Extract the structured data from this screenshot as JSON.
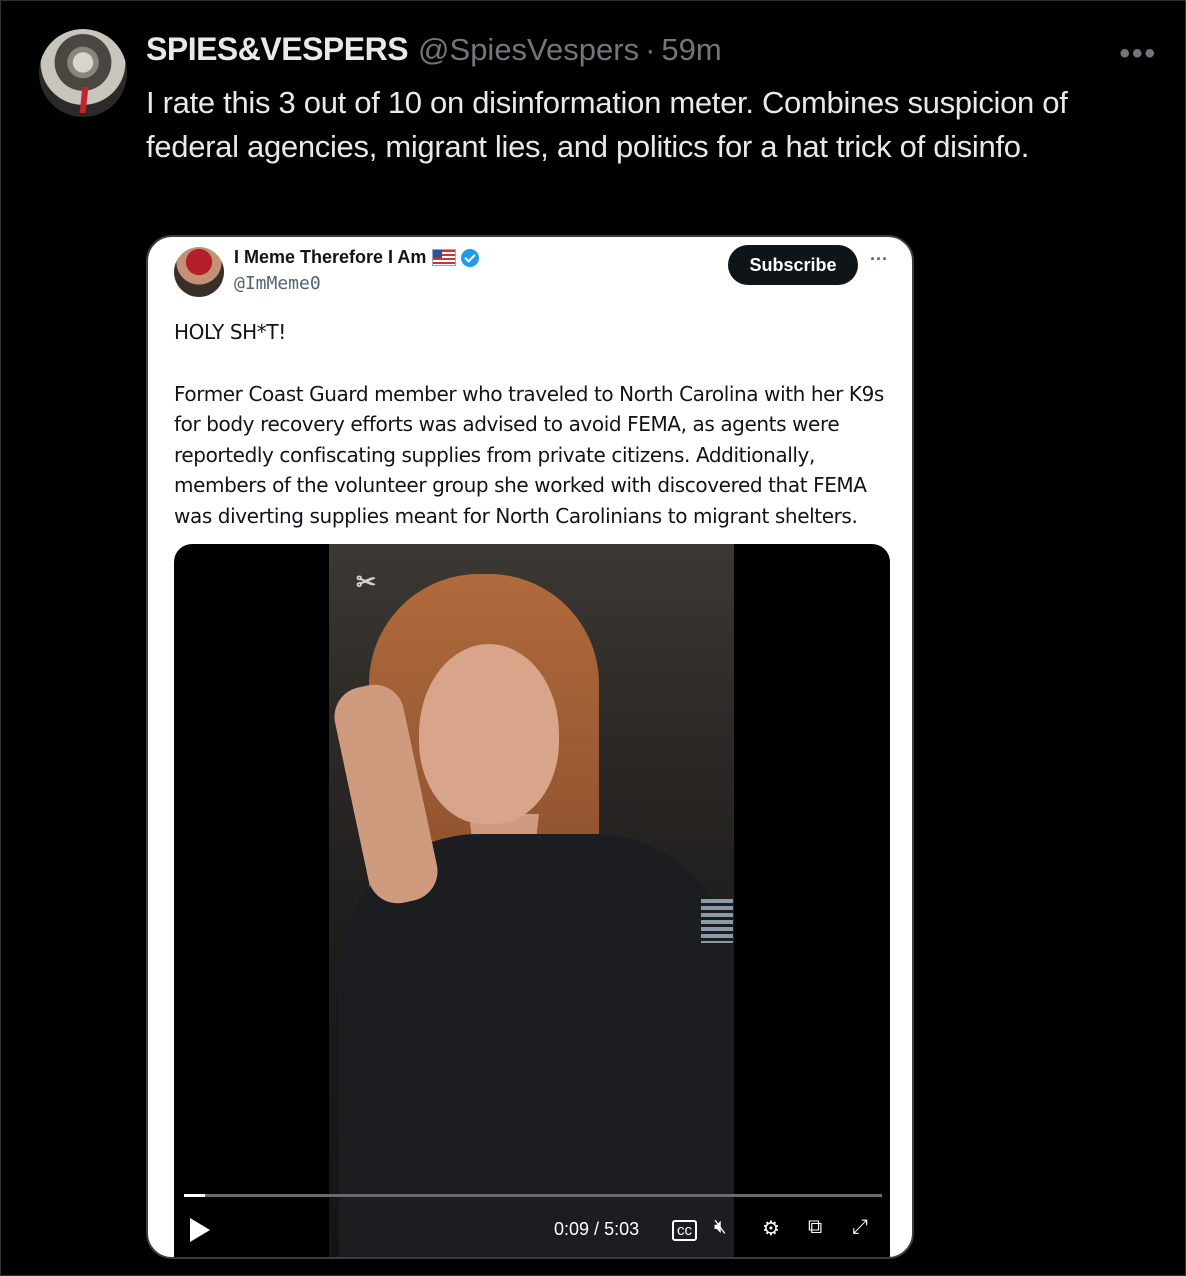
{
  "tweet": {
    "display_name": "SPIES&VESPERS",
    "handle": "@SpiesVespers",
    "separator": "·",
    "age": "59m",
    "more_label": "•••",
    "text": "I rate this 3 out of 10 on disinformation meter. Combines suspicion of federal agencies, migrant lies, and politics for a hat trick of disinfo."
  },
  "quoted": {
    "display_name": "I Meme Therefore I Am",
    "handle": "@ImMeme0",
    "subscribe_label": "Subscribe",
    "more_label": "···",
    "headline": "HOLY SH*T!",
    "body": "Former Coast Guard member who traveled to North Carolina with her K9s for body recovery efforts was advised to avoid FEMA, as agents were reportedly confiscating supplies from private citizens. Additionally, members of the volunteer group she worked with discovered that FEMA was diverting supplies meant for North Carolinians to migrant shelters."
  },
  "video": {
    "watermark_icon": "capcut-icon",
    "current_time": "0:09",
    "duration": "5:03",
    "time_sep": " / ",
    "progress_fraction": 0.03,
    "controls": [
      "play-icon",
      "captions-icon",
      "mute-icon",
      "settings-icon",
      "pip-icon",
      "fullscreen-icon"
    ]
  }
}
